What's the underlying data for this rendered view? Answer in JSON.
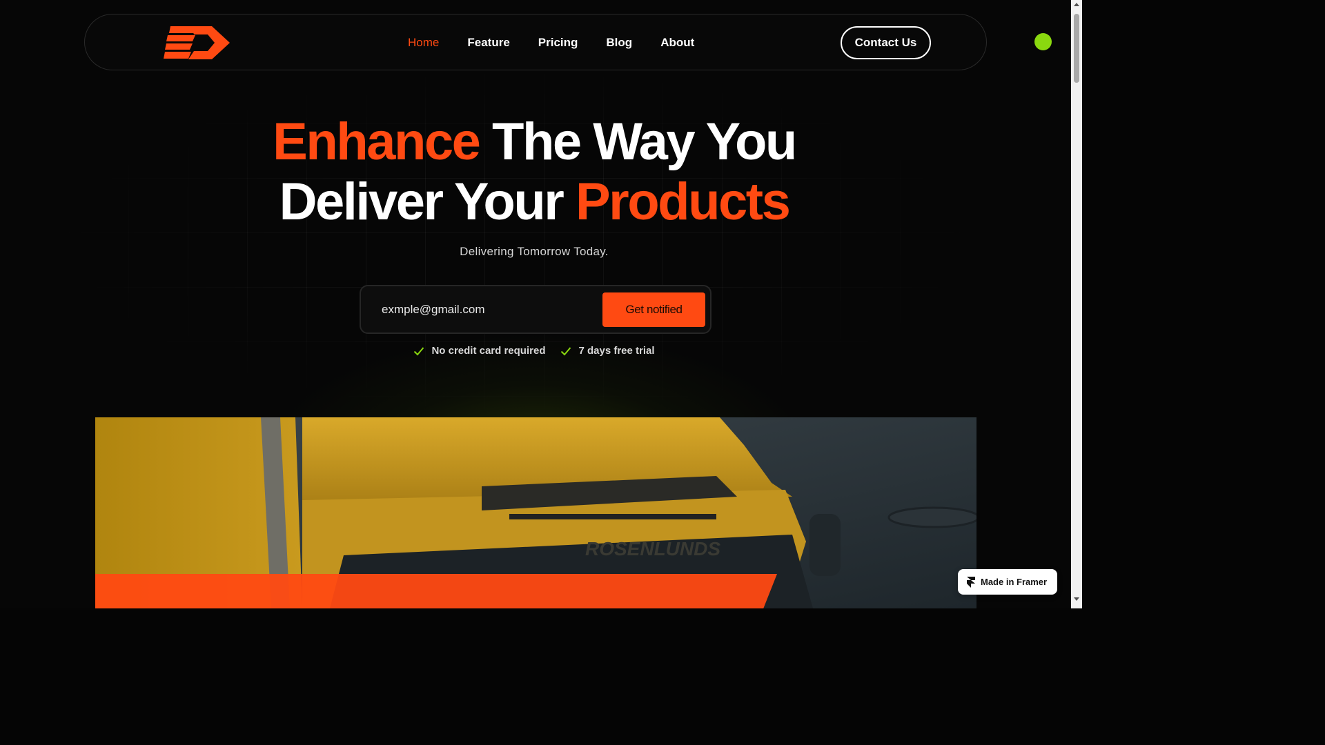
{
  "nav": {
    "links": [
      {
        "label": "Home",
        "active": true
      },
      {
        "label": "Feature",
        "active": false
      },
      {
        "label": "Pricing",
        "active": false
      },
      {
        "label": "Blog",
        "active": false
      },
      {
        "label": "About",
        "active": false
      }
    ],
    "contact_label": "Contact Us",
    "logo_icon": "arrow-speed-logo-icon"
  },
  "hero": {
    "title_part1_accent": "Enhance",
    "title_part1_rest": " The Way You",
    "title_part2_start": "Deliver Your ",
    "title_part2_accent": "Products",
    "subtitle": "Delivering Tomorrow Today."
  },
  "signup": {
    "email_value": "exmple@gmail.com",
    "button_label": "Get notified"
  },
  "perks": [
    {
      "label": "No credit card required",
      "icon": "check-icon"
    },
    {
      "label": "7 days free trial",
      "icon": "check-icon"
    }
  ],
  "image": {
    "truck_text": "ROSENLUNDS"
  },
  "badge": {
    "label": "Made in Framer",
    "icon": "framer-icon"
  },
  "colors": {
    "accent": "#ff4a12",
    "background": "#060606",
    "status_dot": "#8ad80f",
    "check": "#8ad80f"
  }
}
